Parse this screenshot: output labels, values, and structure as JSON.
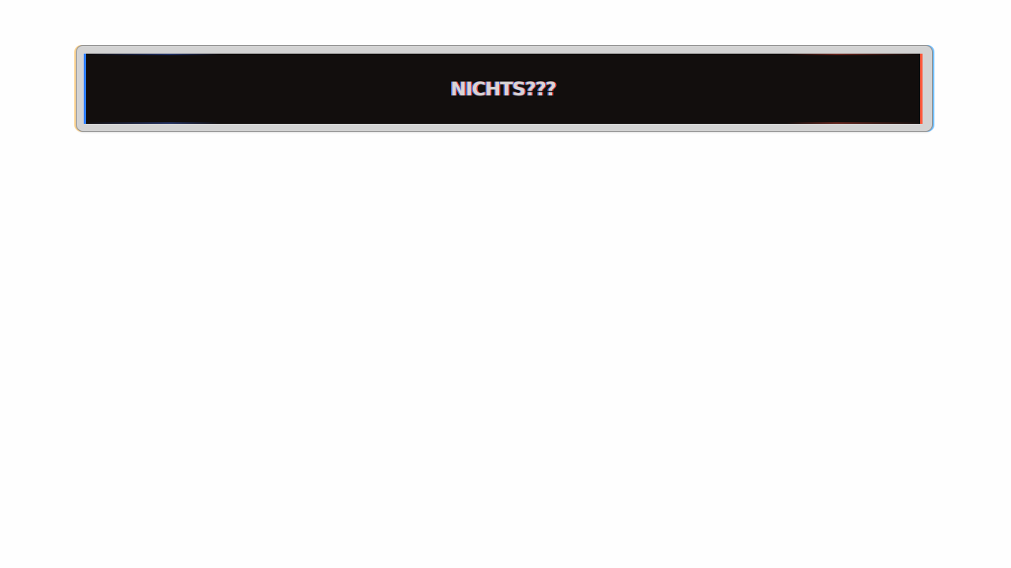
{
  "banner": {
    "text": "NICHTS???"
  },
  "colors": {
    "background": "#fefefe",
    "frame": "#d3d3d3",
    "panel": "#120e0d",
    "text": "#d8d4d2",
    "fringe_left": "#2c7cff",
    "fringe_right": "#ff5a3c"
  }
}
